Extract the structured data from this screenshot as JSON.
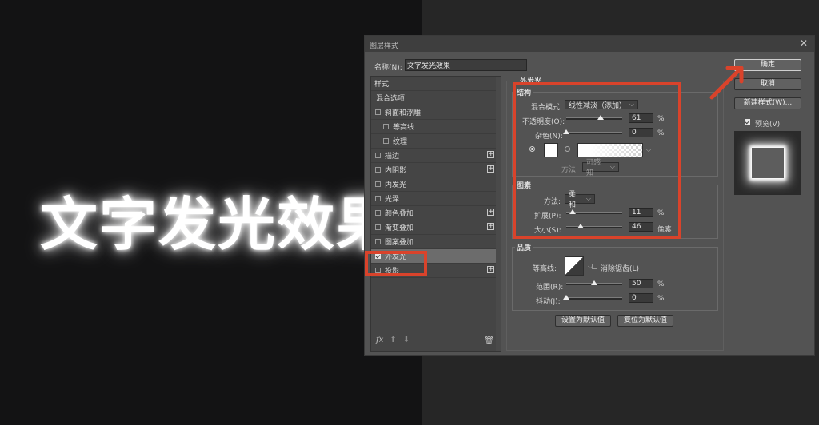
{
  "headline": "文字发光效果",
  "dialog": {
    "title": "图层样式",
    "name_label": "名称(N):",
    "name_value": "文字发光效果"
  },
  "style_list": {
    "header": "样式",
    "items": [
      {
        "label": "混合选项",
        "checkbox": false,
        "indent": false,
        "plus": false,
        "checked": false
      },
      {
        "label": "斜面和浮雕",
        "checkbox": true,
        "indent": false,
        "plus": false,
        "checked": false
      },
      {
        "label": "等高线",
        "checkbox": true,
        "indent": true,
        "plus": false,
        "checked": false
      },
      {
        "label": "纹理",
        "checkbox": true,
        "indent": true,
        "plus": false,
        "checked": false
      },
      {
        "label": "描边",
        "checkbox": true,
        "indent": false,
        "plus": true,
        "checked": false
      },
      {
        "label": "内阴影",
        "checkbox": true,
        "indent": false,
        "plus": true,
        "checked": false
      },
      {
        "label": "内发光",
        "checkbox": true,
        "indent": false,
        "plus": false,
        "checked": false
      },
      {
        "label": "光泽",
        "checkbox": true,
        "indent": false,
        "plus": false,
        "checked": false
      },
      {
        "label": "颜色叠加",
        "checkbox": true,
        "indent": false,
        "plus": true,
        "checked": false
      },
      {
        "label": "渐变叠加",
        "checkbox": true,
        "indent": false,
        "plus": true,
        "checked": false
      },
      {
        "label": "图案叠加",
        "checkbox": true,
        "indent": false,
        "plus": false,
        "checked": false
      },
      {
        "label": "外发光",
        "checkbox": true,
        "indent": false,
        "plus": false,
        "checked": true
      },
      {
        "label": "投影",
        "checkbox": true,
        "indent": false,
        "plus": true,
        "checked": false
      }
    ],
    "footer_fx": "fx",
    "footer_up": "⬆",
    "footer_down": "⬇",
    "footer_trash": "🗑"
  },
  "outer_glow": {
    "title": "外发光",
    "structure": {
      "title": "结构",
      "blend_mode_label": "混合模式:",
      "blend_mode_value": "线性减淡（添加）",
      "opacity_label": "不透明度(O):",
      "opacity_value": 61,
      "opacity_unit": "%",
      "noise_label": "杂色(N):",
      "noise_value": 0,
      "noise_unit": "%",
      "method_label": "方法:",
      "method_value": "可感知"
    },
    "elements": {
      "title": "图素",
      "technique_label": "方法:",
      "technique_value": "柔和",
      "spread_label": "扩展(P):",
      "spread_value": 11,
      "spread_unit": "%",
      "size_label": "大小(S):",
      "size_value": 46,
      "size_unit": "像素"
    },
    "quality": {
      "title": "品质",
      "contour_label": "等高线:",
      "antialias_label": "消除锯齿(L)",
      "range_label": "范围(R):",
      "range_value": 50,
      "range_unit": "%",
      "jitter_label": "抖动(J):",
      "jitter_value": 0,
      "jitter_unit": "%"
    },
    "set_default": "设置为默认值",
    "reset_default": "复位为默认值"
  },
  "buttons": {
    "ok": "确定",
    "cancel": "取消",
    "new_style": "新建样式(W)...",
    "preview": "预览(V)"
  },
  "colors": {
    "accent_red": "#d9432b",
    "dialog_bg": "#535353",
    "glow_color": "#ffffff"
  }
}
